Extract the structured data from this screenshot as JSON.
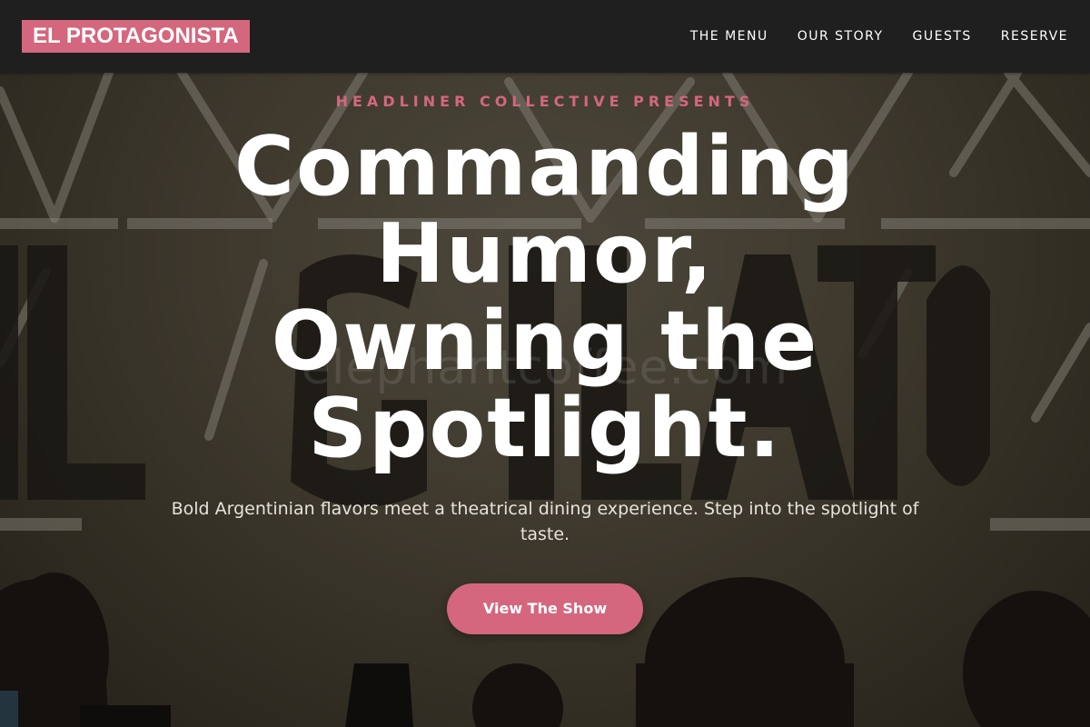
{
  "brand": {
    "logo_text": "EL PROTAGONISTA",
    "accent_color": "#d4677d"
  },
  "nav": {
    "items": [
      {
        "label": "THE MENU"
      },
      {
        "label": "OUR STORY"
      },
      {
        "label": "GUESTS"
      },
      {
        "label": "RESERVE"
      }
    ]
  },
  "hero": {
    "eyebrow": "HEADLINER COLLECTIVE PRESENTS",
    "headline": "Commanding Humor, Owning the Spotlight.",
    "subtitle": "Bold Argentinian flavors meet a theatrical dining experience. Step into the spotlight of taste.",
    "cta_label": "View The Show",
    "watermark_text": "elephantcoffee.com"
  }
}
